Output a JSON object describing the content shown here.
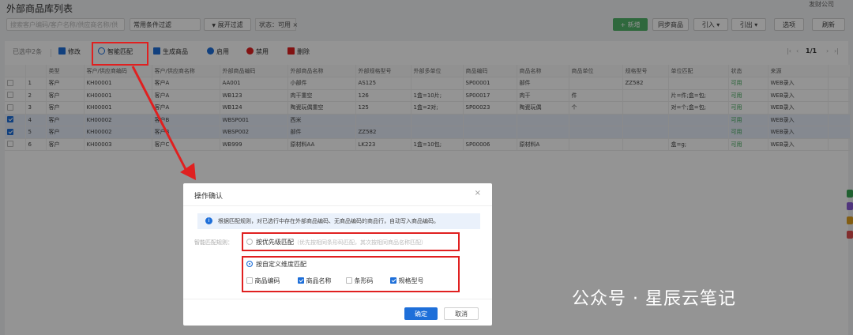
{
  "header": {
    "title": "外部商品库列表",
    "company": "发财公司"
  },
  "filter": {
    "search_placeholder": "搜索客户编码/客户名称/供应商名称/供",
    "condition_value": "常用条件过滤",
    "expand_label": "展开过滤",
    "status_chip": "状态：可用",
    "chip_close": "×",
    "expand_icon": "▼"
  },
  "actions": {
    "new": "新增",
    "sync": "同步商品",
    "import": "引入",
    "export": "引出",
    "options": "选项",
    "refresh": "刷新",
    "caret": "▾",
    "plus": "+"
  },
  "toolbar": {
    "selected": "已选中2条",
    "edit": "修改",
    "match": "智能匹配",
    "generate": "生成商品",
    "enable": "启用",
    "disable": "禁用",
    "delete": "删除",
    "pager": "1/1",
    "first": "|‹",
    "prev": "‹",
    "next": "›",
    "last": "›|"
  },
  "table": {
    "columns": [
      "",
      "",
      "类型",
      "客户/供应商编码",
      "客户/供应商名称",
      "外部商品编码",
      "外部商品名称",
      "外部规格型号",
      "外部多单位",
      "商品编码",
      "商品名称",
      "商品单位",
      "规格型号",
      "单位匹配",
      "状态",
      "来源",
      ""
    ],
    "rows": [
      {
        "n": "1",
        "type": "客户",
        "code": "KH00001",
        "name": "客户A",
        "ext_code": "AA001",
        "ext_name": "小部件",
        "ext_spec": "AS125",
        "multi": "",
        "sku": "SP00001",
        "prod": "部件",
        "unit": "",
        "spec": "ZZ582",
        "unit_match": "",
        "status": "可用",
        "src": "WEB录入",
        "selected": false
      },
      {
        "n": "2",
        "type": "客户",
        "code": "KH00001",
        "name": "客户A",
        "ext_code": "WB123",
        "ext_name": "肉干重空",
        "ext_spec": "126",
        "multi": "1盒=10片;",
        "sku": "SP00017",
        "prod": "肉干",
        "unit": "件",
        "spec": "",
        "unit_match": "片=件;盒=包;",
        "status": "可用",
        "src": "WEB录入",
        "selected": false
      },
      {
        "n": "3",
        "type": "客户",
        "code": "KH00001",
        "name": "客户A",
        "ext_code": "WB124",
        "ext_name": "陶瓷玩偶重空",
        "ext_spec": "125",
        "multi": "1盒=2对;",
        "sku": "SP00023",
        "prod": "陶瓷玩偶",
        "unit": "个",
        "spec": "",
        "unit_match": "对=个;盒=包;",
        "status": "可用",
        "src": "WEB录入",
        "selected": false
      },
      {
        "n": "4",
        "type": "客户",
        "code": "KH00002",
        "name": "客户B",
        "ext_code": "WBSP001",
        "ext_name": "西米",
        "ext_spec": "",
        "multi": "",
        "sku": "",
        "prod": "",
        "unit": "",
        "spec": "",
        "unit_match": "",
        "status": "可用",
        "src": "WEB录入",
        "selected": true
      },
      {
        "n": "5",
        "type": "客户",
        "code": "KH00002",
        "name": "客户B",
        "ext_code": "WBSP002",
        "ext_name": "部件",
        "ext_spec": "ZZ582",
        "multi": "",
        "sku": "",
        "prod": "",
        "unit": "",
        "spec": "",
        "unit_match": "",
        "status": "可用",
        "src": "WEB录入",
        "selected": true
      },
      {
        "n": "6",
        "type": "客户",
        "code": "KH00003",
        "name": "客户C",
        "ext_code": "WB999",
        "ext_name": "原材料AA",
        "ext_spec": "LK223",
        "multi": "1盒=10包;",
        "sku": "SP00006",
        "prod": "原材料A",
        "unit": "",
        "spec": "",
        "unit_match": "盒=g;",
        "status": "可用",
        "src": "WEB录入",
        "selected": false
      }
    ]
  },
  "dialog": {
    "title": "操作确认",
    "close": "×",
    "info_icon": "i",
    "info": "根据匹配规则，对已选行中存在外部商品编码、无商品编码的商品行，自动写入商品编码。",
    "rule_label": "智能匹配规则：",
    "opt1": "按优先级匹配",
    "opt1_hint": "（优先按相同条形码匹配，其次按相同商品名称匹配）",
    "opt2": "按自定义维度匹配",
    "checks": [
      {
        "label": "商品编码",
        "checked": false
      },
      {
        "label": "商品名称",
        "checked": true
      },
      {
        "label": "条形码",
        "checked": false
      },
      {
        "label": "规格型号",
        "checked": true
      }
    ],
    "ok": "确定",
    "cancel": "取消"
  },
  "watermark": "公众号 · 星辰云笔记",
  "colors": {
    "primary": "#1e6fd9",
    "success": "#52b36a",
    "highlight": "#e02020"
  }
}
